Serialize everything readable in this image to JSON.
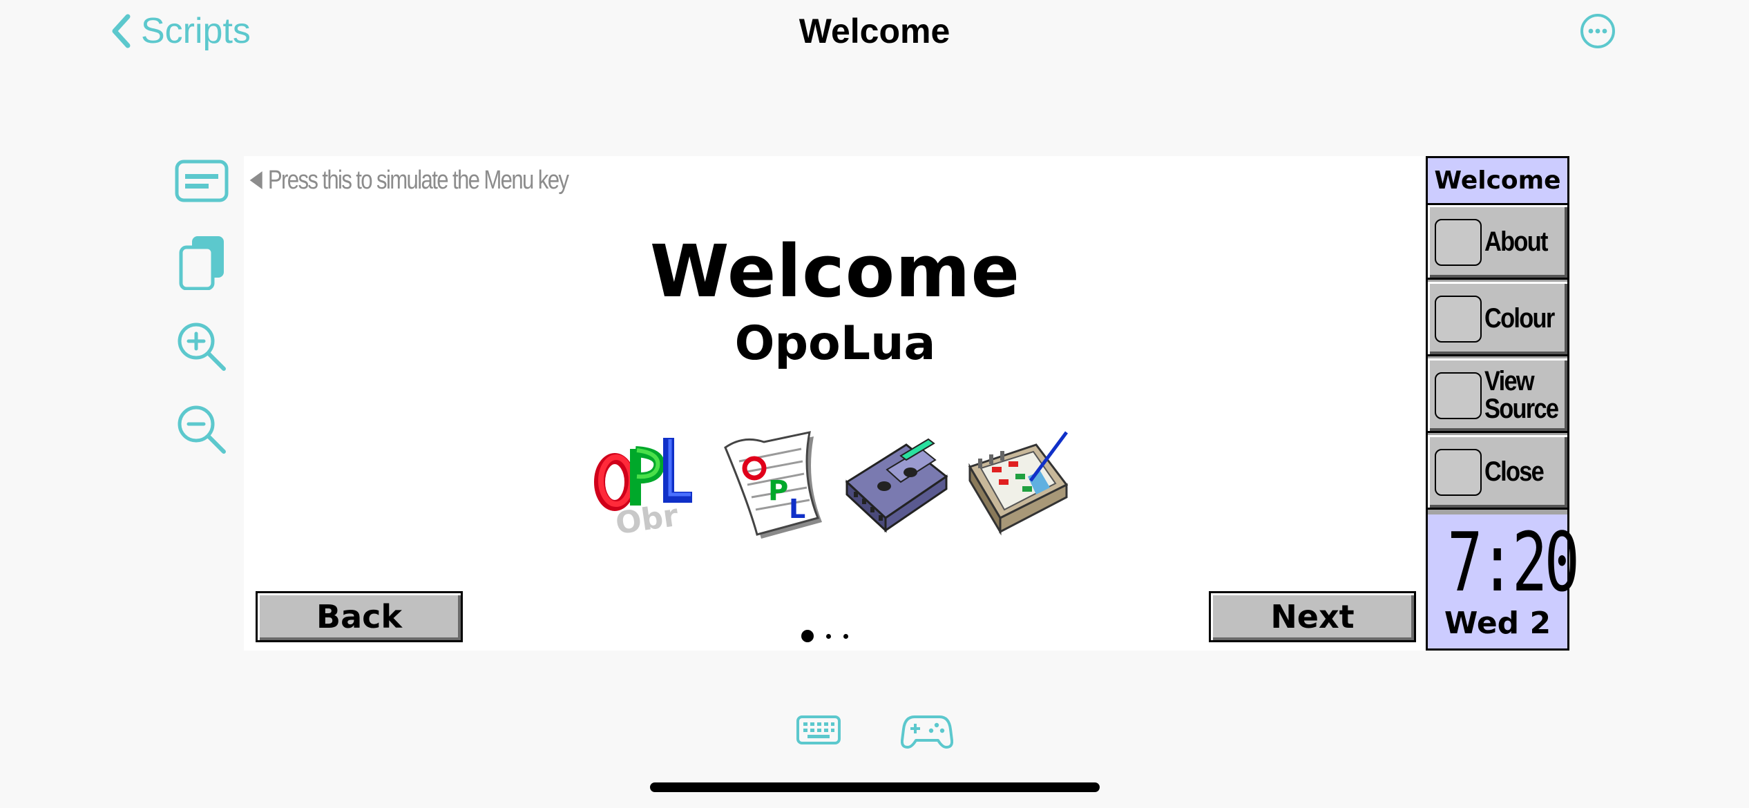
{
  "nav": {
    "back_label": "Scripts",
    "title": "Welcome",
    "more_icon": "ellipsis-circle-icon"
  },
  "tools": [
    {
      "icon": "menu-key-icon"
    },
    {
      "icon": "clipboard-copy-icon"
    },
    {
      "icon": "zoom-in-icon"
    },
    {
      "icon": "zoom-out-icon"
    }
  ],
  "screen": {
    "menu_hint": "Press this to simulate the Menu key",
    "title": "Welcome",
    "subtitle": "OpoLua",
    "icons": [
      "opl-logo-icon",
      "opl-document-icon",
      "cassette-tape-icon",
      "agenda-calendar-icon"
    ],
    "back_button": "Back",
    "next_button": "Next",
    "page_dots": {
      "count": 3,
      "current": 1
    }
  },
  "toolbar": {
    "title": "Welcome",
    "buttons": [
      {
        "label": "About"
      },
      {
        "label": "Colour"
      },
      {
        "label": "View\nSource"
      },
      {
        "label": "Close"
      }
    ],
    "clock_time": "7:20",
    "clock_date": "Wed 2"
  },
  "bottom": {
    "icons": [
      "keyboard-icon",
      "game-controller-icon"
    ]
  },
  "colors": {
    "accent": "#5cc8cd",
    "toolbar_highlight": "#ccccff",
    "button_face": "#c0c0c0"
  }
}
